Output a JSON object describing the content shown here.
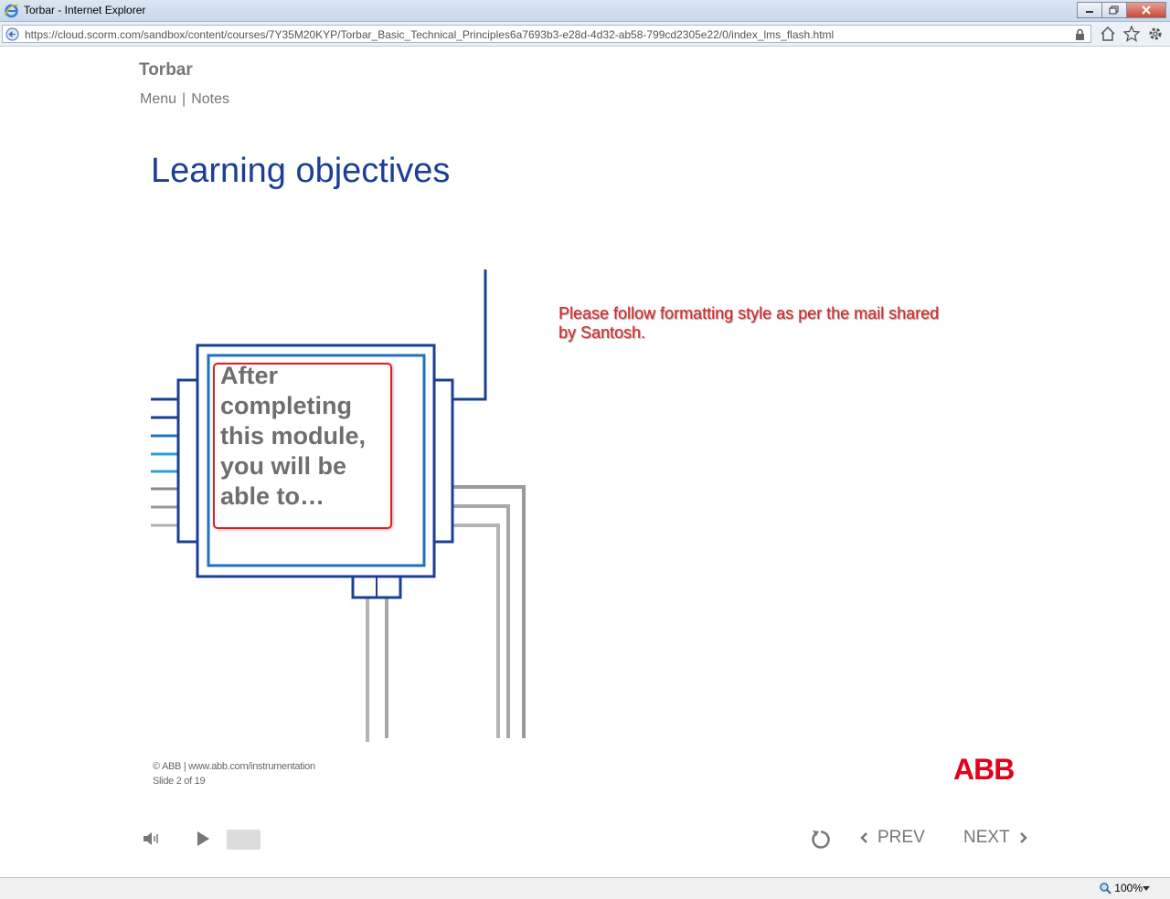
{
  "window": {
    "title": "Torbar - Internet Explorer",
    "url": "https://cloud.scorm.com/sandbox/content/courses/7Y35M20KYP/Torbar_Basic_Technical_Principles6a7693b3-e28d-4d32-ab58-799cd2305e22/0/index_lms_flash.html"
  },
  "course": {
    "title": "Torbar",
    "nav": {
      "menu": "Menu",
      "separator": "|",
      "notes": "Notes"
    }
  },
  "slide": {
    "heading": "Learning objectives",
    "box_text": "After completing this module, you will be able to…",
    "annotation": "Please follow formatting style as per the mail shared by Santosh.",
    "footer_copyright": "© ABB | www.abb.com/instrumentation",
    "footer_slide": "Slide 2 of 19",
    "logo_text": "ABB"
  },
  "player": {
    "prev_label": "PREV",
    "next_label": "NEXT",
    "icons": [
      "volume-icon",
      "play-icon",
      "replay-icon",
      "chevron-left-icon",
      "chevron-right-icon"
    ]
  },
  "statusbar": {
    "zoom": "100%"
  },
  "colors": {
    "heading": "#1b3f94",
    "annotation": "#e02020",
    "abb_red": "#e2001a",
    "chip_blue": "#1b3f94",
    "chip_light_blue": "#1e73be"
  }
}
